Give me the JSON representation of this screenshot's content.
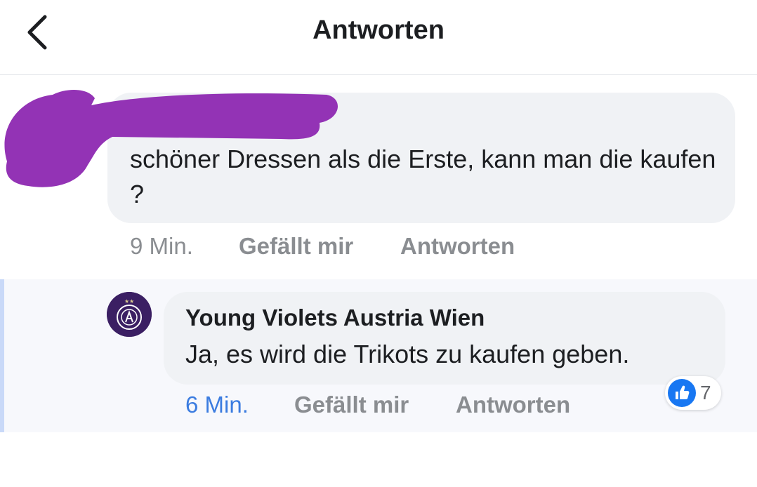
{
  "header": {
    "title": "Antworten",
    "back_icon": "chevron-left-icon"
  },
  "comment": {
    "text": "schöner Dressen als die Erste, kann man die kaufen ?",
    "redaction_color": "#9333b5",
    "time": "9 Min.",
    "like_label": "Gefällt mir",
    "reply_label": "Antworten"
  },
  "reply": {
    "author": "Young Violets Austria Wien",
    "text": "Ja, es wird die Trikots zu kaufen geben.",
    "time": "6 Min.",
    "like_label": "Gefällt mir",
    "reply_label": "Antworten",
    "reaction_icon": "thumbs-up-icon",
    "reaction_count": "7",
    "avatar_color": "#3b1f63"
  },
  "colors": {
    "bubble": "#f0f2f5",
    "meta_gray": "#8a8d91",
    "link_blue": "#3b7ce0",
    "like_blue": "#1877f2",
    "thread_line": "#c9d9f8"
  }
}
